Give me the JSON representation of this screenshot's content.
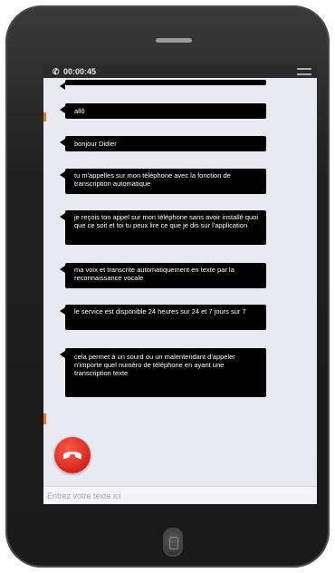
{
  "status": {
    "phone_icon": "phone-icon",
    "call_timer": "00:00:45"
  },
  "messages": [
    {
      "text": ""
    },
    {
      "text": "allô"
    },
    {
      "text": "bonjour Didier"
    },
    {
      "text": "tu m'appelles sur mon téléphone avec la fonction de transcription automatique"
    },
    {
      "text": "je reçois ton appel sur mon téléphone sans avoir installé quoi que ce soit et toi tu peux lire ce que je dis sur l'application"
    },
    {
      "text": "ma voix et transcrite automatiquement en texte par la reconnaissance vocale"
    },
    {
      "text": "le service est disponible 24 heures sur 24 et 7 jours sur 7"
    },
    {
      "text": "cela permet à un sourd ou un malentendant d'appeler n'importe quel numéro de téléphone en ayant une transcription texte"
    }
  ],
  "composer": {
    "placeholder": "Entrez votre texte ici"
  },
  "colors": {
    "bubble": "#000000",
    "screen_bg": "#e9eaf1",
    "hangup": "#e0281c",
    "accent": "#e87722"
  }
}
